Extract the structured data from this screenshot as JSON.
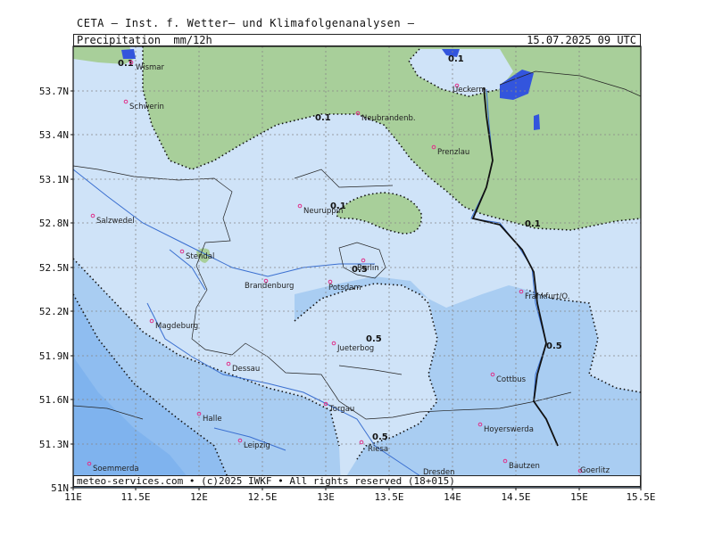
{
  "header": {
    "title": "CETA – Inst. f. Wetter– und Klimafolgenanalysen –",
    "parameter": "Precipitation  mm/12h",
    "valid_time": "15.07.2025 09 UTC"
  },
  "footer": {
    "text": "meteo-services.com • (c)2025 IWKF • All rights reserved (18+015)"
  },
  "axes": {
    "lat_labels": [
      "53.7N",
      "53.4N",
      "53.1N",
      "52.8N",
      "52.5N",
      "52.2N",
      "51.9N",
      "51.6N",
      "51.3N",
      "51N"
    ],
    "lon_labels": [
      "11E",
      "11.5E",
      "12E",
      "12.5E",
      "13E",
      "13.5E",
      "14E",
      "14.5E",
      "15E",
      "15.5E"
    ]
  },
  "contour_labels": [
    "0.1",
    "0.1",
    "0.1",
    "0.1",
    "0.1",
    "0.5",
    "0.5",
    "0.5",
    "0.5"
  ],
  "cities": [
    "Wismar",
    "Schwerin",
    "Neubrandenb.",
    "Ueckerm.",
    "Prenzlau",
    "Salzwedel",
    "Neuruppin",
    "Stendal",
    "Berlin",
    "Potsdam",
    "Brandenburg",
    "Frankfurt/O.",
    "Magdeburg",
    "Jueterbog",
    "Dessau",
    "Cottbus",
    "Torgau",
    "Halle",
    "Hoyerswerda",
    "Leipzig",
    "Riesa",
    "Bautzen",
    "Goerlitz",
    "Soemmerda",
    "Dresden"
  ],
  "colors": {
    "green": "#a8cf9a",
    "lightblue": "#cfe3f8",
    "midblue": "#a9cdf2",
    "deepblue": "#7fb3ee",
    "blue_cells": "#3355dd",
    "city_marker": "#e0308a",
    "river": "#3a6fd0"
  }
}
